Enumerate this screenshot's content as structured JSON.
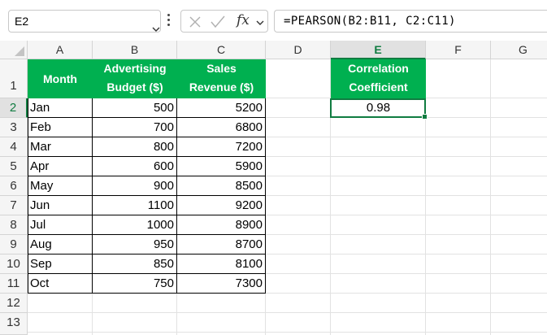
{
  "formula_bar": {
    "name_box": "E2",
    "fx_label": "fx",
    "formula": "=PEARSON(B2:B11, C2:C11)"
  },
  "columns": [
    "A",
    "B",
    "C",
    "D",
    "E",
    "F",
    "G"
  ],
  "rows": [
    "1",
    "2",
    "3",
    "4",
    "5",
    "6",
    "7",
    "8",
    "9",
    "10",
    "11",
    "12",
    "13"
  ],
  "table": {
    "headers": {
      "month": "Month",
      "budget_line1": "Advertising",
      "budget_line2": "Budget ($)",
      "revenue_line1": "Sales",
      "revenue_line2": "Revenue ($)"
    },
    "rows": [
      {
        "month": "Jan",
        "budget": "500",
        "revenue": "5200"
      },
      {
        "month": "Feb",
        "budget": "700",
        "revenue": "6800"
      },
      {
        "month": "Mar",
        "budget": "800",
        "revenue": "7200"
      },
      {
        "month": "Apr",
        "budget": "600",
        "revenue": "5900"
      },
      {
        "month": "May",
        "budget": "900",
        "revenue": "8500"
      },
      {
        "month": "Jun",
        "budget": "1100",
        "revenue": "9200"
      },
      {
        "month": "Jul",
        "budget": "1000",
        "revenue": "8900"
      },
      {
        "month": "Aug",
        "budget": "950",
        "revenue": "8700"
      },
      {
        "month": "Sep",
        "budget": "850",
        "revenue": "8100"
      },
      {
        "month": "Oct",
        "budget": "750",
        "revenue": "7300"
      }
    ]
  },
  "correlation": {
    "header_line1": "Correlation",
    "header_line2": "Coefficient",
    "value": "0.98"
  },
  "selection": {
    "cell": "E2",
    "column": "E",
    "row": "2"
  },
  "colors": {
    "header_fill": "#00b050",
    "selection": "#107c41"
  },
  "icons": [
    "chevron-down-icon",
    "more-options-icon",
    "cancel-icon",
    "enter-check-icon",
    "insert-function-icon"
  ]
}
